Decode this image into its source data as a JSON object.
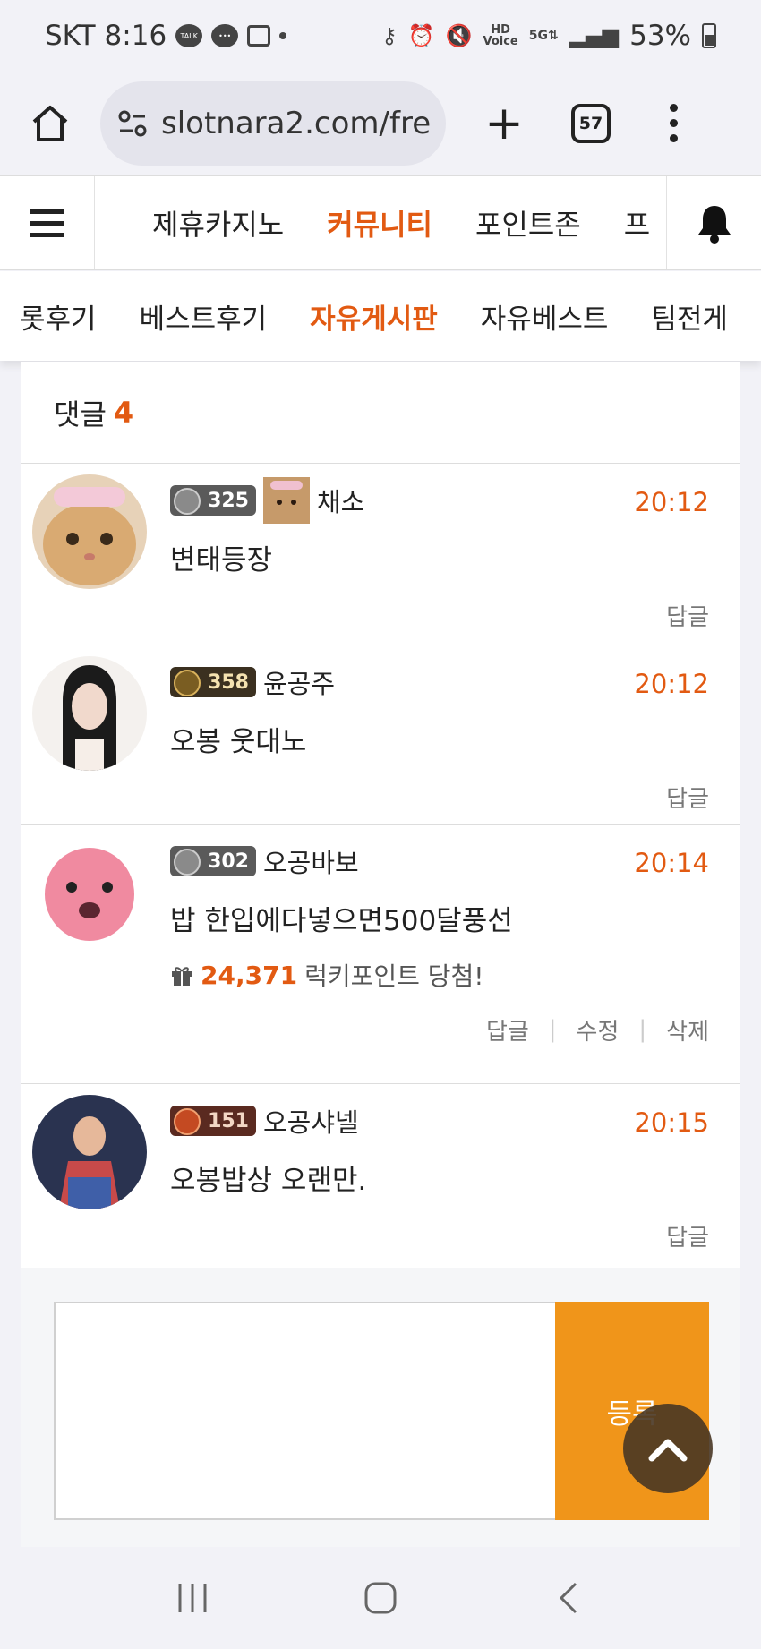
{
  "status_bar": {
    "carrier": "SKT",
    "time": "8:16",
    "talk_badge": "TALK",
    "battery": "53%",
    "icons": [
      "talk-icon",
      "chat-icon",
      "gallery-icon",
      "key-icon",
      "alarm-icon",
      "mute-icon",
      "hd-voice-icon",
      "5g-icon",
      "signal-icon",
      "battery-icon"
    ]
  },
  "browser": {
    "url": "slotnara2.com/fre",
    "tab_count": "57"
  },
  "site_nav": {
    "items": [
      {
        "label": "제휴카지노"
      },
      {
        "label": "커뮤니티"
      },
      {
        "label": "포인트존"
      },
      {
        "label": "프"
      }
    ],
    "active": "커뮤니티"
  },
  "sub_nav": {
    "items": [
      {
        "label": "롯후기"
      },
      {
        "label": "베스트후기"
      },
      {
        "label": "자유게시판"
      },
      {
        "label": "자유베스트"
      },
      {
        "label": "팀전게"
      }
    ],
    "active": "자유게시판"
  },
  "comments": {
    "title": "댓글",
    "count": "4",
    "items": [
      {
        "level": "325",
        "name": "채소",
        "time": "20:12",
        "text": "변태등장",
        "actions": [
          "답글"
        ]
      },
      {
        "level": "358",
        "name": "윤공주",
        "time": "20:12",
        "text": "오봉 웃대노",
        "actions": [
          "답글"
        ]
      },
      {
        "level": "302",
        "name": "오공바보",
        "time": "20:14",
        "text": "밥 한입에다넣으면500달풍선",
        "lucky_points": "24,371",
        "lucky_text": "럭키포인트 당첨!",
        "actions": [
          "답글",
          "수정",
          "삭제"
        ]
      },
      {
        "level": "151",
        "name": "오공샤넬",
        "time": "20:15",
        "text": "오봉밥상 오랜만.",
        "actions": [
          "답글"
        ]
      }
    ]
  },
  "write": {
    "submit_label": "등록"
  },
  "colors": {
    "accent": "#e25a12",
    "submit": "#f0951a"
  }
}
